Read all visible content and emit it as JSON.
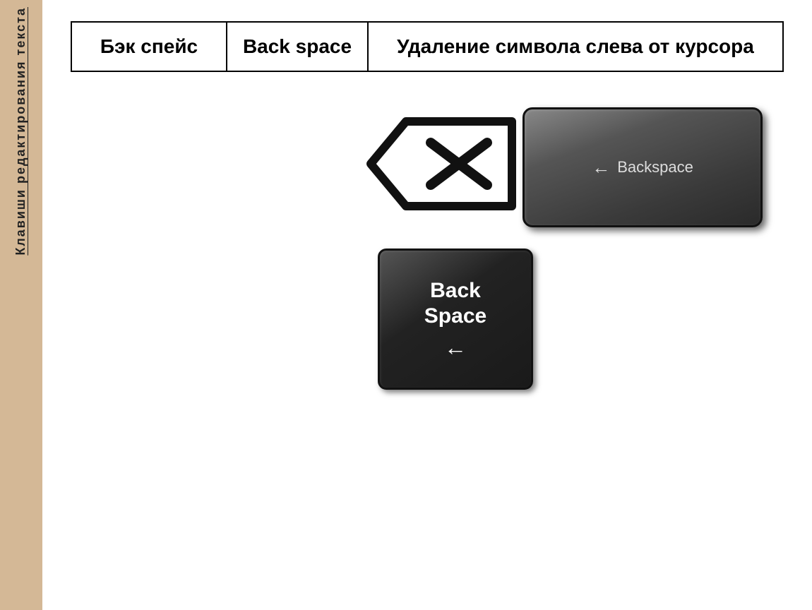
{
  "sidebar": {
    "text": "Клавиши редактирования текста"
  },
  "table": {
    "col1": "Бэк\nспейс",
    "col2": "Back\nspace",
    "col3": "Удаление символа\nслева от курсора"
  },
  "keys": {
    "backspaceDark": {
      "line1": "Back",
      "line2": "Space",
      "arrow": "←"
    },
    "backspaceRight": {
      "arrow": "←",
      "label": "Backspace"
    }
  }
}
